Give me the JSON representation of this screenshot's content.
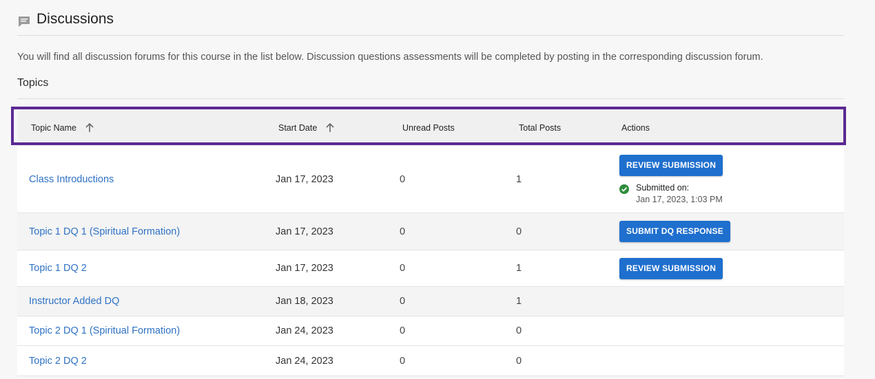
{
  "page": {
    "title": "Discussions",
    "description": "You will find all discussion forums for this course in the list below. Discussion questions assessments will be completed by posting in the corresponding discussion forum.",
    "section_label": "Topics"
  },
  "table": {
    "headers": {
      "topic_name": "Topic Name",
      "start_date": "Start Date",
      "unread_posts": "Unread Posts",
      "total_posts": "Total Posts",
      "actions": "Actions"
    },
    "rows": [
      {
        "topic": "Class Introductions",
        "start_date": "Jan 17, 2023",
        "unread": "0",
        "total": "1",
        "action_label": "REVIEW SUBMISSION",
        "submitted_label": "Submitted on:",
        "submitted_time": "Jan 17, 2023, 1:03 PM"
      },
      {
        "topic": "Topic 1 DQ 1 (Spiritual Formation)",
        "start_date": "Jan 17, 2023",
        "unread": "0",
        "total": "0",
        "action_label": "SUBMIT DQ RESPONSE"
      },
      {
        "topic": "Topic 1 DQ 2",
        "start_date": "Jan 17, 2023",
        "unread": "0",
        "total": "1",
        "action_label": "REVIEW SUBMISSION"
      },
      {
        "topic": "Instructor Added DQ",
        "start_date": "Jan 18, 2023",
        "unread": "0",
        "total": "1"
      },
      {
        "topic": "Topic 2 DQ 1 (Spiritual Formation)",
        "start_date": "Jan 24, 2023",
        "unread": "0",
        "total": "0"
      },
      {
        "topic": "Topic 2 DQ 2",
        "start_date": "Jan 24, 2023",
        "unread": "0",
        "total": "0"
      }
    ]
  },
  "icons": {
    "header": "discussion-bubble-icon",
    "sort": "arrow-up-icon",
    "submitted": "check-circle-icon"
  },
  "colors": {
    "link": "#2f72c4",
    "button": "#1f6fce",
    "highlight_border": "#5b2a92",
    "success": "#2e8b3a"
  }
}
